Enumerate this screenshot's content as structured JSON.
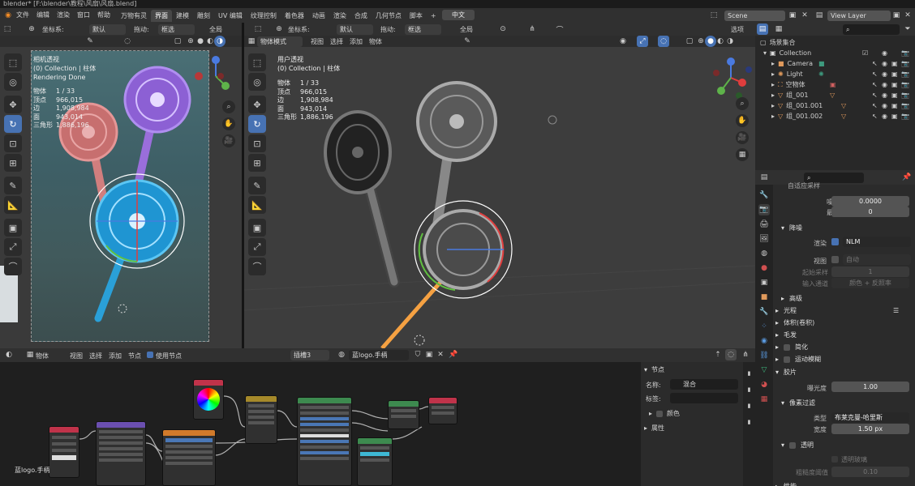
{
  "titlebar": {
    "title": "blender* [F:\\blender\\教程\\风扇\\风扇.blend]"
  },
  "menu": [
    "文件",
    "编辑",
    "渲染",
    "窗口",
    "帮助"
  ],
  "workspaces": [
    "万物有灵",
    "界面",
    "建模",
    "雕刻",
    "UV 编辑",
    "纹理控制",
    "着色器",
    "动画",
    "渲染",
    "合成",
    "几何节点",
    "脚本"
  ],
  "active_workspace": "界面",
  "lang_btn": "中文",
  "scene": "Scene",
  "view_layer": "View Layer",
  "left_header": {
    "coord_label": "坐标系:",
    "coord_val": "默认",
    "drag_label": "拖动:",
    "drag_val": "框选",
    "global": "全局"
  },
  "left_overlay": [
    "相机透视",
    "(0) Collection | 柱体",
    "Rendering Done"
  ],
  "stats_labels": [
    "物体",
    "顶点",
    "边",
    "面",
    "三角形"
  ],
  "stats_values": [
    "1 / 33",
    "966,015",
    "1,908,984",
    "943,014",
    "1,886,196"
  ],
  "right_header": {
    "mode": "物体模式",
    "view": "视图",
    "select": "选择",
    "add": "添加",
    "object": "物体",
    "coord_label": "坐标系:",
    "coord_val": "默认",
    "drag_label": "拖动:",
    "drag_val": "框选",
    "global": "全局",
    "options": "选项"
  },
  "right_overlay": [
    "用户透视",
    "(0) Collection | 柱体"
  ],
  "node_header": {
    "object": "物体",
    "view": "视图",
    "select": "选择",
    "add": "添加",
    "node": "节点",
    "use_nodes": "使用节点",
    "slot": "插槽3",
    "material": "蓝logo.手柄"
  },
  "node_label": "蓝logo.手柄",
  "node_sidebar": {
    "title": "节点",
    "name_label": "名称:",
    "name_val": "混合",
    "label_label": "标签:",
    "color": "颜色",
    "props": "属性"
  },
  "outliner": {
    "root": "场景集合",
    "items": [
      {
        "name": "Collection",
        "indent": 0
      },
      {
        "name": "Camera",
        "indent": 1
      },
      {
        "name": "Light",
        "indent": 1
      },
      {
        "name": "空物体",
        "indent": 1
      },
      {
        "name": "组_001",
        "indent": 1
      },
      {
        "name": "组_001.001",
        "indent": 1
      },
      {
        "name": "组_001.002",
        "indent": 1
      }
    ]
  },
  "props": {
    "top_clip": "自适应采样",
    "noise_label": "噪波阈值",
    "noise_val": "0.0000",
    "min_label": "最小采样",
    "min_val": "0",
    "denoise": "降噪",
    "render_label": "渲染",
    "render_val": "NLM",
    "viewport_label": "视图",
    "viewport_val": "自动",
    "start_label": "起始采样",
    "start_val": "1",
    "input_label": "输入通道",
    "input_val": "颜色 + 反照率",
    "advanced": "高级",
    "light_paths": "光程",
    "volume": "体积(卷积)",
    "hair": "毛发",
    "simplify": "简化",
    "motion_blur": "运动模糊",
    "film": "胶片",
    "exposure_label": "曝光度",
    "exposure_val": "1.00",
    "pixel_filter": "像素过滤",
    "type_label": "类型",
    "type_val": "布莱克曼-哈里斯",
    "width_label": "宽度",
    "width_val": "1.50 px",
    "transparent": "透明",
    "trans_glass": "透明玻璃",
    "rough_label": "粗糙度阈值",
    "rough_val": "0.10",
    "perf": "性能"
  },
  "colors": {
    "accent": "#4772b3",
    "selected_orange": "#f5a142",
    "fan_blue": "#2aa0d8",
    "fan_purple": "#9b6fe0",
    "fan_pink": "#e27c7c"
  }
}
